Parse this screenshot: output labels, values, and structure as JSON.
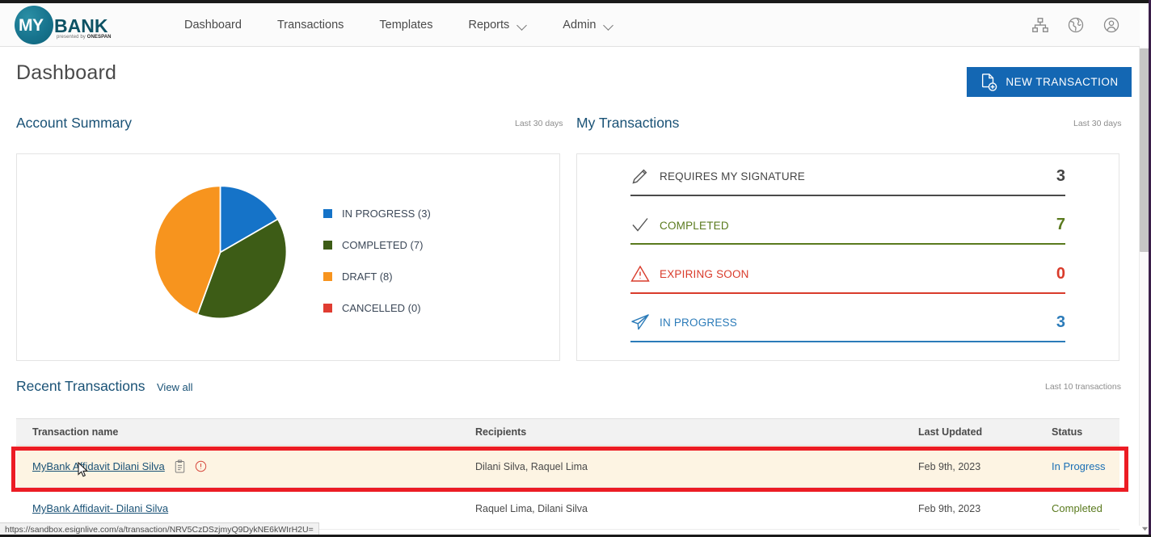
{
  "brand": {
    "logo_my": "MY",
    "logo_bank": "BANK",
    "logo_tagline_prefix": "presented by ",
    "logo_tagline_brand": "ONESPAN",
    "accent_blue": "#1467b3",
    "title_blue": "#1a5276"
  },
  "nav": {
    "items": [
      {
        "label": "Dashboard",
        "has_chevron": false
      },
      {
        "label": "Transactions",
        "has_chevron": false
      },
      {
        "label": "Templates",
        "has_chevron": false
      },
      {
        "label": "Reports",
        "has_chevron": true
      },
      {
        "label": "Admin",
        "has_chevron": true
      }
    ],
    "right_icons": [
      "sitemap-icon",
      "globe-icon",
      "user-account-icon"
    ]
  },
  "page": {
    "title": "Dashboard",
    "new_transaction_label": "NEW TRANSACTION"
  },
  "account_summary": {
    "title": "Account Summary",
    "period": "Last 30 days"
  },
  "chart_data": {
    "type": "pie",
    "title": "Account Summary",
    "legend_position": "right",
    "categories": [
      "IN PROGRESS",
      "COMPLETED",
      "DRAFT",
      "CANCELLED"
    ],
    "values": [
      3,
      7,
      8,
      0
    ],
    "total": 18,
    "labels": [
      "IN PROGRESS (3)",
      "COMPLETED (7)",
      "DRAFT (8)",
      "CANCELLED (0)"
    ],
    "colors": [
      "#1573c8",
      "#3d5c16",
      "#f7941e",
      "#e03c31"
    ],
    "start_angle_deg": 0,
    "direction": "clockwise"
  },
  "my_transactions": {
    "title": "My Transactions",
    "period": "Last 30 days",
    "rows": [
      {
        "icon": "pencil-icon",
        "label": "REQUIRES MY SIGNATURE",
        "count": "3",
        "color": "#444444",
        "rule_color": "#4a4a4a"
      },
      {
        "icon": "check-icon",
        "label": "COMPLETED",
        "count": "7",
        "color": "#5a7a1e",
        "rule_color": "#5a7a1e"
      },
      {
        "icon": "warning-icon",
        "label": "EXPIRING SOON",
        "count": "0",
        "color": "#d93b2b",
        "rule_color": "#d93b2b"
      },
      {
        "icon": "paper-plane-icon",
        "label": "IN PROGRESS",
        "count": "3",
        "color": "#2b7bb9",
        "rule_color": "#2b7bb9"
      }
    ]
  },
  "recent_transactions": {
    "title": "Recent Transactions",
    "view_all_label": "View all",
    "note": "Last 10 transactions",
    "columns": [
      "Transaction name",
      "Recipients",
      "Last Updated",
      "Status"
    ],
    "rows": [
      {
        "name": "MyBank Affidavit Dilani Silva",
        "recipients": "Dilani Silva, Raquel Lima",
        "last_updated": "Feb 9th, 2023",
        "status": "In Progress",
        "status_color": "#1a6fb5",
        "icons": [
          "clipboard-icon",
          "alert-circle-icon"
        ],
        "highlighted": true
      },
      {
        "name": "MyBank Affidavit- Dilani Silva",
        "recipients": "Raquel Lima, Dilani Silva",
        "last_updated": "Feb 9th, 2023",
        "status": "Completed",
        "status_color": "#5a7a1e",
        "icons": [],
        "highlighted": false
      }
    ]
  },
  "status_bar": {
    "url": "https://sandbox.esignlive.com/a/transaction/NRV5CzDSzjmyQ9DykNE6kWIrH2U="
  }
}
